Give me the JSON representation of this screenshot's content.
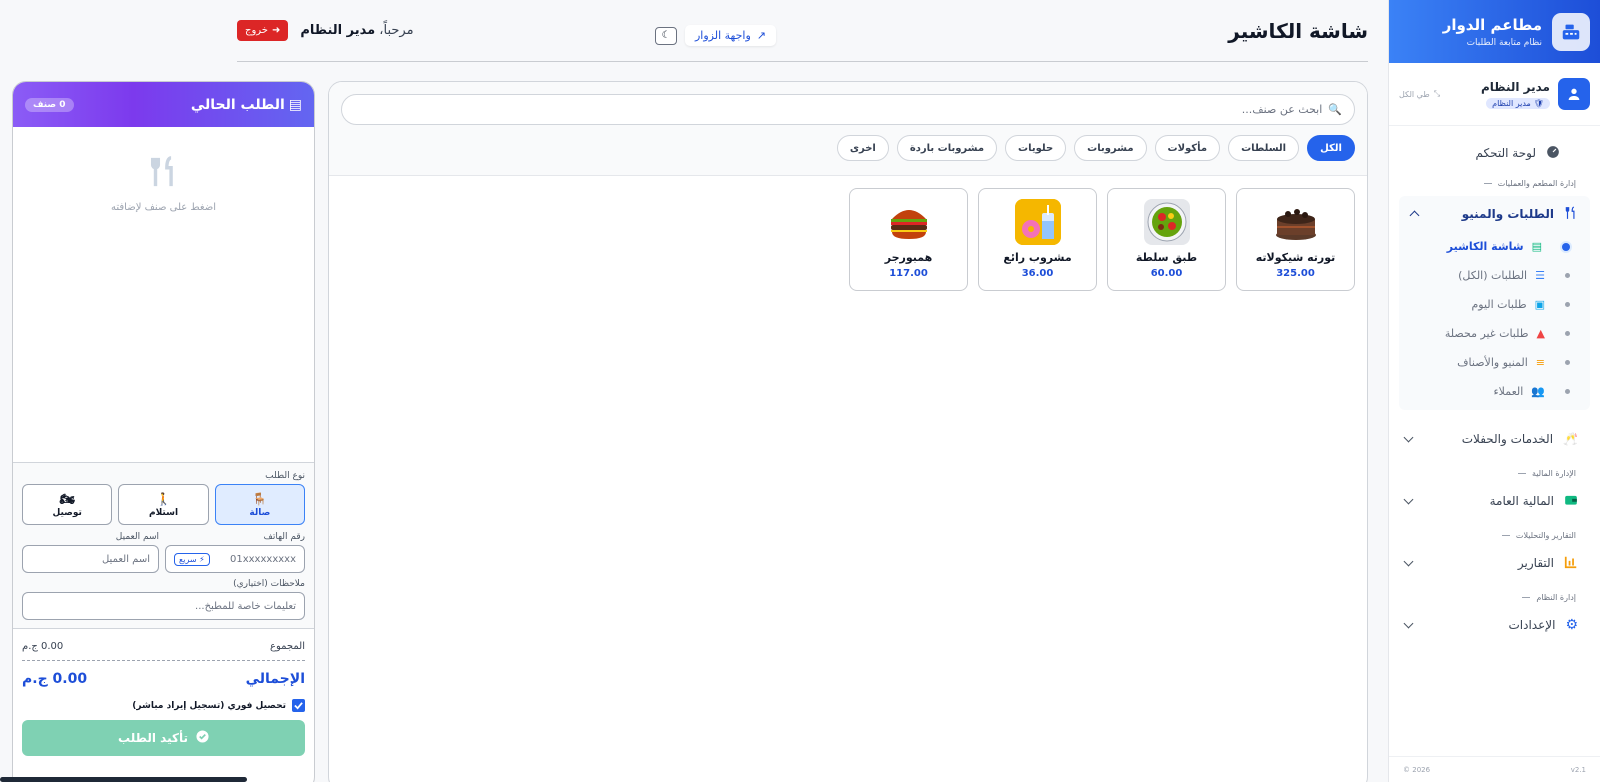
{
  "sidebar": {
    "brand_title": "مطاعم الدوار",
    "brand_subtitle": "نظام متابعة الطلبات",
    "user_name": "مدير النظام",
    "user_role": "مدير النظام",
    "collapse_all": "طي الكل",
    "dashboard": "لوحة التحكم",
    "section_ops": "إدارة المطعم والعمليات",
    "orders_menu": "الطلبات والمنيو",
    "sub_items": [
      {
        "label": "شاشة الكاشير",
        "icon": "cash-register-icon"
      },
      {
        "label": "الطلبات (الكل)",
        "icon": "list-icon"
      },
      {
        "label": "طلبات اليوم",
        "icon": "calendar-icon"
      },
      {
        "label": "طلبات غير محصلة",
        "icon": "warning-icon"
      },
      {
        "label": "المنيو والأصناف",
        "icon": "burger-icon"
      },
      {
        "label": "العملاء",
        "icon": "users-icon"
      }
    ],
    "services": "الخدمات والحفلات",
    "section_finance": "الإدارة المالية",
    "finance": "المالية العامة",
    "section_reports": "التقارير والتحليلات",
    "reports": "التقارير",
    "section_system": "إدارة النظام",
    "settings": "الإعدادات",
    "version": "v2.1",
    "year": "2026 ©"
  },
  "header": {
    "title": "شاشة الكاشير",
    "visitor_link": "واجهة الزوار",
    "welcome_prefix": "مرحباً،",
    "welcome_name": "مدير النظام",
    "logout": "خروج"
  },
  "products": {
    "search_placeholder": "ابحث عن صنف...",
    "categories": [
      "الكل",
      "السلطات",
      "مأكولات",
      "مشروبات",
      "حلويات",
      "مشروبات باردة",
      "اخرى"
    ],
    "items": [
      {
        "name": "تورته شيكولاته",
        "price": "325.00",
        "icon": "cake-icon"
      },
      {
        "name": "طبق سلطة",
        "price": "60.00",
        "icon": "salad-icon"
      },
      {
        "name": "مشروب رائع",
        "price": "36.00",
        "icon": "drink-icon"
      },
      {
        "name": "همبورجر",
        "price": "117.00",
        "icon": "burger-icon"
      }
    ]
  },
  "order": {
    "title": "الطلب الحالي",
    "count": "0 صنف",
    "empty_text": "اضغط على صنف لإضافته",
    "type_label": "نوع الطلب",
    "types": [
      "صالة",
      "استلام",
      "توصيل"
    ],
    "phone_label": "رقم الهاتف",
    "phone_placeholder": "01xxxxxxxxx",
    "quick": "سريع",
    "name_label": "اسم العميل",
    "name_placeholder": "اسم العميل",
    "notes_label": "ملاحظات (اختياري)",
    "notes_placeholder": "تعليمات خاصة للمطبخ...",
    "subtotal_label": "المجموع",
    "subtotal_value": "0.00 ج.م",
    "grand_label": "الإجمالي",
    "grand_value": "0.00 ج.م",
    "instant_label": "تحصيل فوري (تسجيل إيراد مباشر)",
    "confirm": "تأكيد الطلب"
  },
  "colors": {
    "accent": "#2563eb",
    "danger": "#dc2626",
    "confirm": "#7fd1b3",
    "order_header": "#8b5cf6"
  }
}
